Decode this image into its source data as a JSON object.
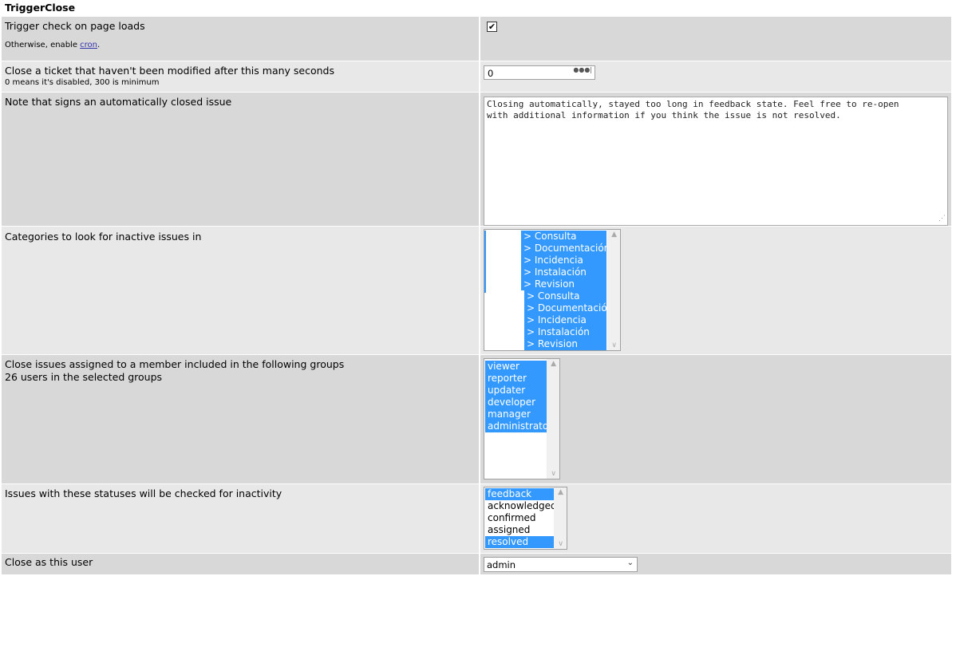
{
  "title": "TriggerClose",
  "rows": {
    "trigger": {
      "label": "Trigger check on page loads",
      "sub_prefix": "Otherwise, enable ",
      "sub_link": "cron",
      "sub_suffix": ".",
      "checked_glyph": "✔"
    },
    "seconds": {
      "label": "Close a ticket that haven't been modified after this many seconds",
      "sub": "0 means it's disabled, 300 is minimum",
      "value": "0"
    },
    "note": {
      "label": "Note that signs an automatically closed issue",
      "value": "Closing automatically, stayed too long in feedback state. Feel free to re-open\nwith additional information if you think the issue is not resolved."
    },
    "categories": {
      "label": "Categories to look for inactive issues in",
      "options": [
        "> Consulta",
        "> Documentación",
        "> Incidencia",
        "> Instalación",
        "> Revision",
        "> Consulta",
        "> Documentación",
        "> Incidencia",
        "> Instalación",
        "> Revision"
      ]
    },
    "groups": {
      "label": "Close issues assigned to a member included in the following groups",
      "sub": "26 users in the selected groups",
      "options": [
        "viewer",
        "reporter",
        "updater",
        "developer",
        "manager",
        "administrator"
      ]
    },
    "statuses": {
      "label": "Issues with these statuses will be checked for inactivity",
      "options": [
        {
          "text": "feedback",
          "selected": true
        },
        {
          "text": "acknowledged",
          "selected": false
        },
        {
          "text": "confirmed",
          "selected": false
        },
        {
          "text": "assigned",
          "selected": false
        },
        {
          "text": "resolved",
          "selected": true
        }
      ]
    },
    "user": {
      "label": "Close as this user",
      "value": "admin"
    }
  },
  "colors": {
    "selection": "#3399ff",
    "row_dark": "#d8d8d8",
    "row_light": "#e8e8e8"
  }
}
